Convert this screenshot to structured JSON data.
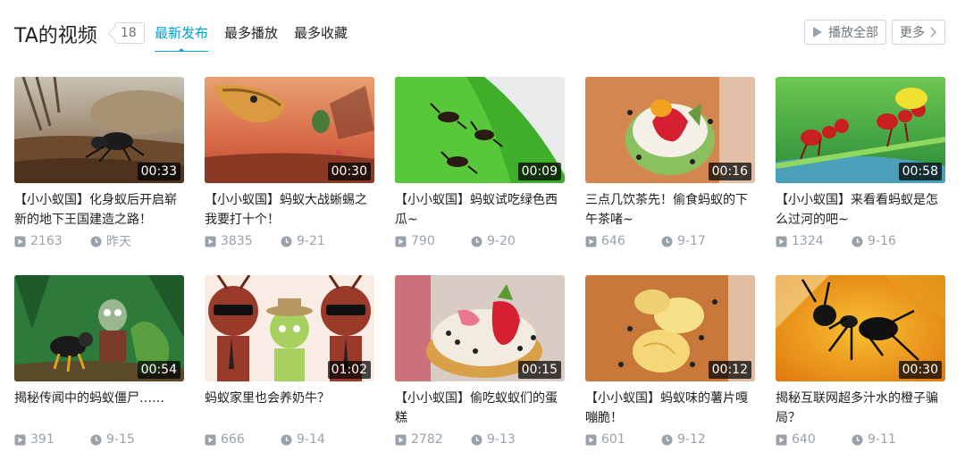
{
  "header": {
    "title": "TA的视频",
    "count": "18",
    "tabs": [
      {
        "label": "最新发布",
        "active": true
      },
      {
        "label": "最多播放",
        "active": false
      },
      {
        "label": "最多收藏",
        "active": false
      }
    ],
    "play_all_label": "播放全部",
    "more_label": "更多"
  },
  "colors": {
    "accent": "#00a1d6",
    "meta_gray": "#99a2aa",
    "text": "#212121"
  },
  "videos": [
    {
      "title": "【小小蚁国】化身蚁后开启崭新的地下王国建造之路！",
      "duration": "00:33",
      "plays": "2163",
      "date": "昨天",
      "thumb": "ant-on-dirt"
    },
    {
      "title": "【小小蚁国】蚂蚁大战蜥蜴之我要打十个！",
      "duration": "00:30",
      "plays": "3835",
      "date": "9-21",
      "thumb": "lizard-sunset"
    },
    {
      "title": "【小小蚁国】蚂蚁试吃绿色西瓜~",
      "duration": "00:09",
      "plays": "790",
      "date": "9-20",
      "thumb": "ants-on-green"
    },
    {
      "title": "三点几饮茶先！偷食蚂蚁的下午茶啫~",
      "duration": "00:16",
      "plays": "646",
      "date": "9-17",
      "thumb": "cake-strawberry"
    },
    {
      "title": "【小小蚁国】来看看蚂蚁是怎么过河的吧~",
      "duration": "00:58",
      "plays": "1324",
      "date": "9-16",
      "thumb": "red-ants-cartoon"
    },
    {
      "title": "揭秘传闻中的蚂蚁僵尸……",
      "duration": "00:54",
      "plays": "391",
      "date": "9-15",
      "thumb": "zombie-cartoon"
    },
    {
      "title": "蚂蚁家里也会养奶牛？",
      "duration": "01:02",
      "plays": "666",
      "date": "9-14",
      "thumb": "ant-characters"
    },
    {
      "title": "【小小蚁国】偷吃蚁蚁们的蛋糕",
      "duration": "00:15",
      "plays": "2782",
      "date": "9-13",
      "thumb": "cake-ants"
    },
    {
      "title": "【小小蚁国】蚂蚁味的薯片嘎嘣脆！",
      "duration": "00:12",
      "plays": "601",
      "date": "9-12",
      "thumb": "chips-ants"
    },
    {
      "title": "揭秘互联网超多汁水的橙子骗局？",
      "duration": "00:30",
      "plays": "640",
      "date": "9-11",
      "thumb": "ant-orange"
    }
  ]
}
